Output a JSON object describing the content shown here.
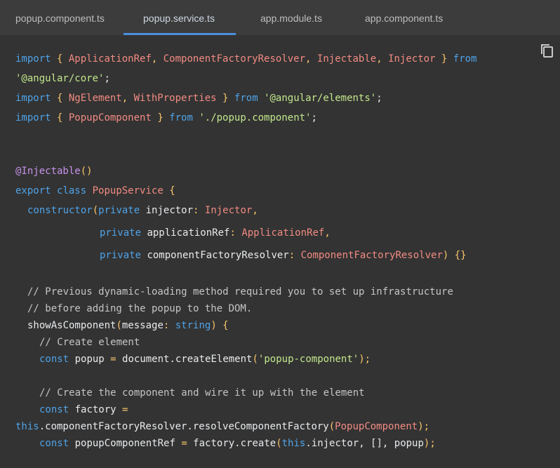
{
  "tabs": [
    {
      "label": "popup.component.ts",
      "active": false
    },
    {
      "label": "popup.service.ts",
      "active": true
    },
    {
      "label": "app.module.ts",
      "active": false
    },
    {
      "label": "app.component.ts",
      "active": false
    }
  ],
  "copy_icon": "copy-icon",
  "code": {
    "l1": [
      "import",
      " { ",
      "ApplicationRef",
      ", ",
      "ComponentFactoryResolver",
      ", ",
      "Injectable",
      ", ",
      "Injector",
      " } ",
      "from"
    ],
    "l2": [
      "'@angular/core'",
      ";"
    ],
    "l3": [
      "import",
      " { ",
      "NgElement",
      ", ",
      "WithProperties",
      " } ",
      "from",
      " ",
      "'@angular/elements'",
      ";"
    ],
    "l4": [
      "import",
      " { ",
      "PopupComponent",
      " } ",
      "from",
      " ",
      "'./popup.component'",
      ";"
    ],
    "l5": [
      "@Injectable",
      "()"
    ],
    "l6": [
      "export",
      " ",
      "class",
      " ",
      "PopupService",
      " {"
    ],
    "l7": [
      "constructor",
      "(",
      "private",
      " injector",
      ": ",
      "Injector",
      ","
    ],
    "l8": [
      "private",
      " applicationRef",
      ": ",
      "ApplicationRef",
      ","
    ],
    "l9": [
      "private",
      " componentFactoryResolver",
      ": ",
      "ComponentFactoryResolver",
      ") {}"
    ],
    "l10": "// Previous dynamic-loading method required you to set up infrastructure",
    "l11": "// before adding the popup to the DOM.",
    "l12": [
      "showAsComponent",
      "(",
      "message",
      ": ",
      "string",
      ") {"
    ],
    "l13": "// Create element",
    "l14": [
      "const",
      " popup ",
      "=",
      " document.createElement",
      "(",
      "'popup-component'",
      ");"
    ],
    "l15": "// Create the component and wire it up with the element",
    "l16": [
      "const",
      " factory ",
      "="
    ],
    "l17": [
      "this",
      ".componentFactoryResolver.resolveComponentFactory",
      "(",
      "PopupComponent",
      ");"
    ],
    "l18": [
      "const",
      " popupComponentRef ",
      "=",
      " factory.create",
      "(",
      "this",
      ".injector, [], popup",
      ");"
    ]
  }
}
